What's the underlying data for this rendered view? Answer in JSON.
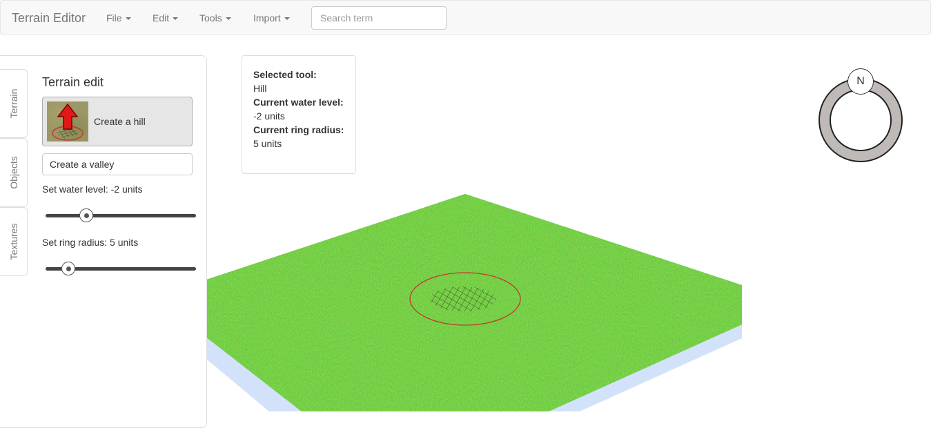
{
  "app": {
    "title": "Terrain Editor"
  },
  "menu": {
    "file": "File",
    "edit": "Edit",
    "tools": "Tools",
    "import": "Import"
  },
  "search": {
    "placeholder": "Search term",
    "value": ""
  },
  "sidebar": {
    "tabs": [
      "Terrain",
      "Objects",
      "Textures"
    ],
    "title": "Terrain edit",
    "tools": {
      "hill": "Create a hill",
      "valley": "Create a valley"
    },
    "water": {
      "label": "Set water level: -2 units",
      "fraction": 0.27
    },
    "radius": {
      "label": "Set ring radius: 5 units",
      "fraction": 0.15
    }
  },
  "info": {
    "tool_heading": "Selected tool:",
    "tool_value": "Hill",
    "water_heading": "Current water level:",
    "water_value": "-2 units",
    "radius_heading": "Current ring radius:",
    "radius_value": "5 units"
  },
  "compass": {
    "north_label": "N"
  },
  "colors": {
    "grass": "#3f9a1f",
    "water": "#d3e2fb",
    "ring": "#c0392b",
    "compass_ring": "#bfb9b7"
  }
}
